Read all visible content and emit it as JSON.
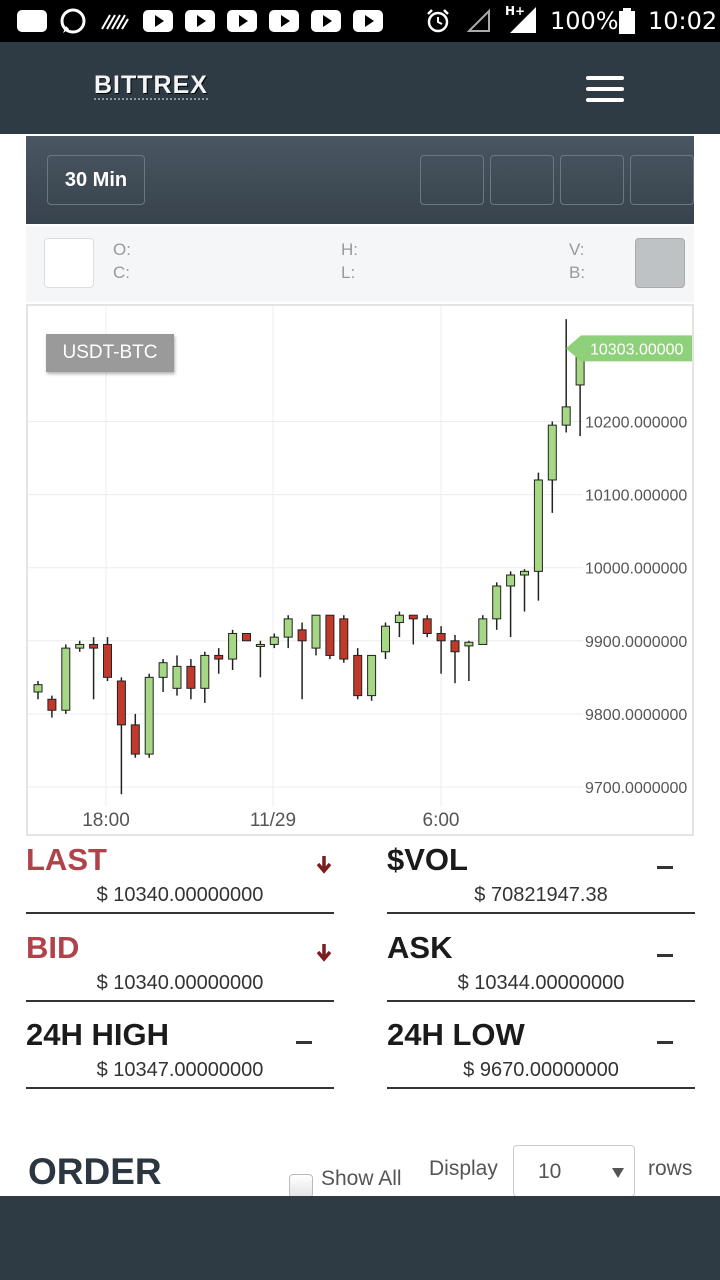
{
  "status_bar": {
    "battery": "100%",
    "time": "10:02",
    "network": "H+"
  },
  "header": {
    "logo": "BITTREX",
    "menu_icon": "hamburger-icon"
  },
  "toolbar": {
    "interval": "30 Min"
  },
  "ohlc": {
    "o_label": "O:",
    "c_label": "C:",
    "h_label": "H:",
    "l_label": "L:",
    "v_label": "V:",
    "b_label": "B:"
  },
  "chart_data": {
    "type": "candlestick",
    "pair": "USDT-BTC",
    "last_price_label": "10303.00000",
    "x_tick_labels": [
      "18:00",
      "11/29",
      "6:00"
    ],
    "y_tick_labels": [
      "10200.000000",
      "10100.000000",
      "10000.000000",
      "9900.0000000",
      "9800.0000000",
      "9700.0000000"
    ],
    "y_ticks": [
      10200,
      10100,
      10000,
      9900,
      9800,
      9700
    ],
    "ylim": [
      9674,
      10358
    ],
    "up_color": "#a6d785",
    "down_color": "#c0392b",
    "candles": [
      [
        9830,
        9845,
        9820,
        9840
      ],
      [
        9820,
        9825,
        9795,
        9805
      ],
      [
        9805,
        9895,
        9800,
        9890
      ],
      [
        9890,
        9900,
        9885,
        9895
      ],
      [
        9895,
        9905,
        9820,
        9890
      ],
      [
        9895,
        9905,
        9845,
        9850
      ],
      [
        9845,
        9850,
        9690,
        9785
      ],
      [
        9785,
        9800,
        9740,
        9745
      ],
      [
        9745,
        9855,
        9740,
        9850
      ],
      [
        9850,
        9875,
        9830,
        9870
      ],
      [
        9835,
        9880,
        9825,
        9865
      ],
      [
        9865,
        9875,
        9820,
        9835
      ],
      [
        9835,
        9885,
        9815,
        9880
      ],
      [
        9880,
        9890,
        9855,
        9875
      ],
      [
        9875,
        9915,
        9860,
        9910
      ],
      [
        9910,
        9910,
        9900,
        9900
      ],
      [
        9895,
        9900,
        9850,
        9895
      ],
      [
        9895,
        9910,
        9890,
        9905
      ],
      [
        9905,
        9935,
        9890,
        9930
      ],
      [
        9915,
        9925,
        9820,
        9900
      ],
      [
        9890,
        9935,
        9880,
        9935
      ],
      [
        9935,
        9935,
        9875,
        9880
      ],
      [
        9930,
        9935,
        9870,
        9875
      ],
      [
        9880,
        9890,
        9820,
        9825
      ],
      [
        9825,
        9880,
        9818,
        9880
      ],
      [
        9885,
        9925,
        9875,
        9920
      ],
      [
        9925,
        9940,
        9905,
        9935
      ],
      [
        9935,
        9935,
        9895,
        9930
      ],
      [
        9930,
        9935,
        9905,
        9910
      ],
      [
        9910,
        9920,
        9855,
        9900
      ],
      [
        9900,
        9908,
        9842,
        9885
      ],
      [
        9893,
        9900,
        9845,
        9898
      ],
      [
        9895,
        9935,
        9895,
        9930
      ],
      [
        9930,
        9980,
        9915,
        9975
      ],
      [
        9975,
        9995,
        9905,
        9990
      ],
      [
        9990,
        9998,
        9940,
        9995
      ],
      [
        9995,
        10130,
        9955,
        10120
      ],
      [
        10120,
        10200,
        10075,
        10195
      ],
      [
        10195,
        10340,
        10185,
        10220
      ],
      [
        10250,
        10303,
        10180,
        10300
      ]
    ]
  },
  "stats": {
    "last": {
      "label": "LAST",
      "value": "$ 10340.00000000",
      "trend": "arrow-down-icon"
    },
    "vol": {
      "label": "$VOL",
      "value": "$ 70821947.38",
      "trend": "dash-icon"
    },
    "bid": {
      "label": "BID",
      "value": "$ 10340.00000000",
      "trend": "arrow-down-icon"
    },
    "ask": {
      "label": "ASK",
      "value": "$ 10344.00000000",
      "trend": "dash-icon"
    },
    "high": {
      "label": "24H HIGH",
      "value": "$ 10347.00000000",
      "trend": "dash-icon"
    },
    "low": {
      "label": "24H LOW",
      "value": "$ 9670.00000000",
      "trend": "dash-icon"
    }
  },
  "order": {
    "title": "ORDER",
    "show_all": "Show All",
    "display_label": "Display",
    "display_value": "10",
    "rows_label": "rows"
  }
}
